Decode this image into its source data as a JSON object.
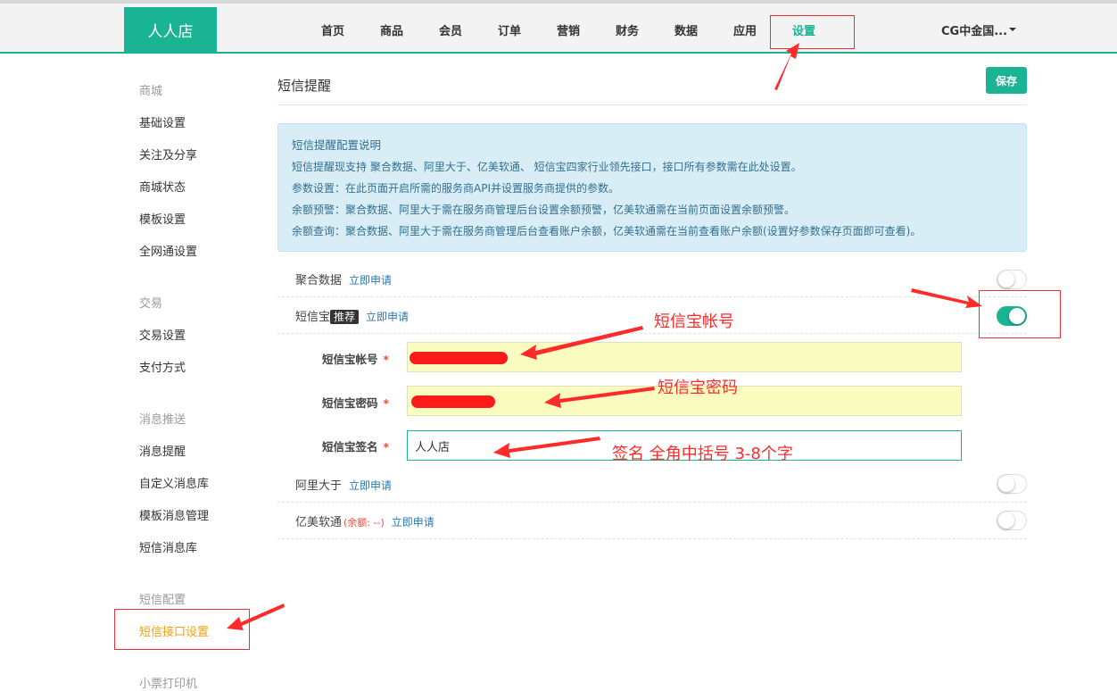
{
  "header": {
    "logo": "人人店",
    "nav": [
      "首页",
      "商品",
      "会员",
      "订单",
      "营销",
      "财务",
      "数据",
      "应用",
      "设置"
    ],
    "active_nav": "设置",
    "account": "CG中金国..."
  },
  "sidebar": {
    "groups": [
      {
        "title": "商城",
        "items": [
          "基础设置",
          "关注及分享",
          "商城状态",
          "模板设置",
          "全网通设置"
        ]
      },
      {
        "title": "交易",
        "items": [
          "交易设置",
          "支付方式"
        ]
      },
      {
        "title": "消息推送",
        "items": [
          "消息提醒",
          "自定义消息库",
          "模板消息管理",
          "短信消息库"
        ]
      },
      {
        "title": "短信配置",
        "items": [
          "短信接口设置"
        ]
      },
      {
        "title": "小票打印机",
        "items": []
      }
    ],
    "active_item": "短信接口设置"
  },
  "main": {
    "title": "短信提醒",
    "save_label": "保存",
    "info": {
      "title": "短信提醒配置说明",
      "lines": [
        "短信提醒现支持 聚合数据、阿里大于、亿美软通、 短信宝四家行业领先接口，接口所有参数需在此处设置。",
        "参数设置：在此页面开启所需的服务商API并设置服务商提供的参数。",
        "余额预警：聚合数据、阿里大于需在服务商管理后台设置余额预警，亿美软通需在当前页面设置余额预警。",
        "余额查询：聚合数据、阿里大于需在服务商管理后台查看账户余额，亿美软通需在当前查看账户余额(设置好参数保存页面即可查看)。"
      ]
    },
    "apply_label": "立即申请",
    "providers": [
      {
        "name": "聚合数据",
        "enabled": false
      },
      {
        "name": "短信宝",
        "badge": "推荐",
        "enabled": true
      },
      {
        "name": "阿里大于",
        "enabled": false
      },
      {
        "name": "亿美软通",
        "balance": "(余额: --)",
        "enabled": false
      }
    ],
    "fields": [
      {
        "label": "短信宝帐号",
        "required": "*",
        "value": ""
      },
      {
        "label": "短信宝密码",
        "required": "*",
        "value": ""
      },
      {
        "label": "短信宝签名",
        "required": "*",
        "value": "人人店"
      }
    ]
  },
  "annotations": {
    "account": "短信宝帐号",
    "password": "短信宝密码",
    "signature": "签名 全角中括号 3-8个字"
  },
  "colors": {
    "accent": "#1ab394",
    "annotation": "#ff2b2b",
    "info_bg": "#d9edf7"
  }
}
